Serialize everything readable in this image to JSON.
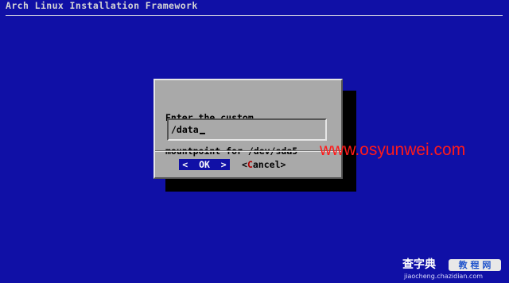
{
  "header": {
    "title": "Arch Linux Installation Framework"
  },
  "dialog": {
    "prompt_line1": "Enter the custom",
    "prompt_line2": "mountpoint for /dev/sda5",
    "input_value": "/data",
    "ok": {
      "left_bracket": "<",
      "label": "OK",
      "right_bracket": ">"
    },
    "cancel": {
      "left_bracket": "<",
      "hotkey": "C",
      "label_rest": "ancel",
      "right_bracket": ">"
    }
  },
  "watermark": {
    "url": "www.osyunwei.com"
  },
  "logo": {
    "name": "查字典",
    "badge": "教 程 网",
    "domain": "jiaocheng.chazidian.com"
  },
  "colors": {
    "background": "#1010a6",
    "dialog": "#a9a9a9",
    "shadow": "#000000",
    "hotkey": "#b00000",
    "watermark": "#ff1a1a"
  }
}
